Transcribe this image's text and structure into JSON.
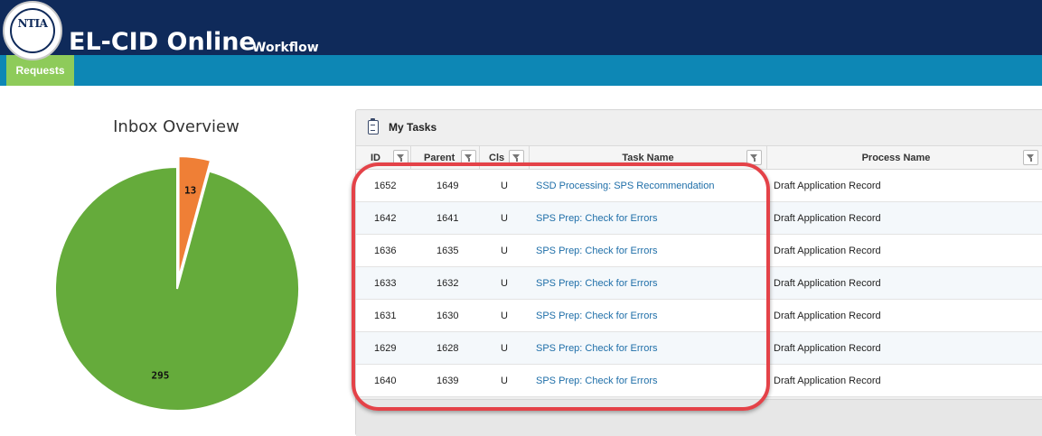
{
  "header": {
    "logo_text": "NTIA",
    "title": "EL-CID Online",
    "subtitle": "Workflow"
  },
  "nav": {
    "tabs": [
      {
        "label": "Requests",
        "active": true
      }
    ]
  },
  "chart_data": {
    "type": "pie",
    "title": "Inbox Overview",
    "slices": [
      {
        "label": "13",
        "value": 13,
        "color": "#ef7f36",
        "exploded": true
      },
      {
        "label": "295",
        "value": 295,
        "color": "#65ab3b"
      }
    ]
  },
  "tasks": {
    "title": "My Tasks",
    "columns": [
      "ID",
      "Parent",
      "Cls",
      "Task Name",
      "Process Name"
    ],
    "rows": [
      {
        "id": "1652",
        "parent": "1649",
        "cls": "U",
        "task": "SSD Processing: SPS Recommendation",
        "process": "Draft Application Record"
      },
      {
        "id": "1642",
        "parent": "1641",
        "cls": "U",
        "task": "SPS Prep: Check for Errors",
        "process": "Draft Application Record"
      },
      {
        "id": "1636",
        "parent": "1635",
        "cls": "U",
        "task": "SPS Prep: Check for Errors",
        "process": "Draft Application Record"
      },
      {
        "id": "1633",
        "parent": "1632",
        "cls": "U",
        "task": "SPS Prep: Check for Errors",
        "process": "Draft Application Record"
      },
      {
        "id": "1631",
        "parent": "1630",
        "cls": "U",
        "task": "SPS Prep: Check for Errors",
        "process": "Draft Application Record"
      },
      {
        "id": "1629",
        "parent": "1628",
        "cls": "U",
        "task": "SPS Prep: Check for Errors",
        "process": "Draft Application Record"
      },
      {
        "id": "1640",
        "parent": "1639",
        "cls": "U",
        "task": "SPS Prep: Check for Errors",
        "process": "Draft Application Record"
      }
    ]
  },
  "colors": {
    "header": "#0f2a5a",
    "nav": "#0d87b5",
    "active_tab": "#8ecb5a",
    "link": "#1e6ea8",
    "annotation": "#e44248"
  }
}
